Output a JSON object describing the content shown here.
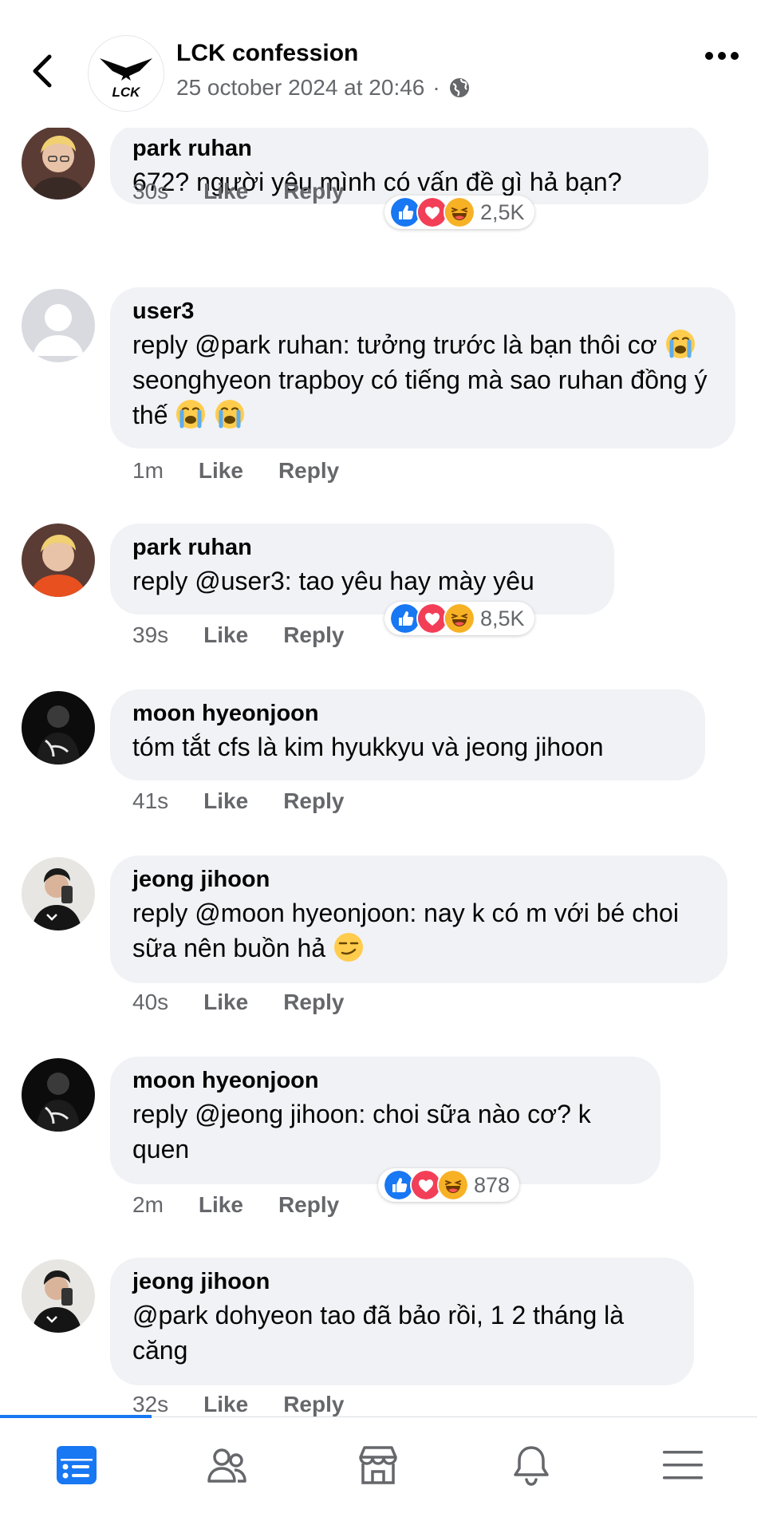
{
  "post": {
    "page_name": "LCK confession",
    "timestamp": "25 october 2024 at 20:46",
    "separator": "·",
    "logo_text": "LCK",
    "privacy_icon": "globe-icon"
  },
  "comments": [
    {
      "author": "park ruhan",
      "text": "672? người yêu mình có vấn đề gì hả bạn?",
      "time": "30s",
      "like": "Like",
      "reply": "Reply",
      "reactions": [
        "like",
        "love",
        "haha"
      ],
      "reaction_count": "2,5K"
    },
    {
      "author": "user3",
      "text_before": "reply @park ruhan: tưởng trước là bạn thôi cơ",
      "text_after": "seonghyeon trapboy có tiếng mà sao ruhan đồng ý thế",
      "emoji": [
        "loudly-crying-face",
        "loudly-crying-face",
        "loudly-crying-face"
      ],
      "time": "1m",
      "like": "Like",
      "reply": "Reply"
    },
    {
      "author": "park ruhan",
      "text": "reply @user3: tao yêu hay mày yêu",
      "time": "39s",
      "like": "Like",
      "reply": "Reply",
      "reactions": [
        "like",
        "love",
        "haha"
      ],
      "reaction_count": "8,5K"
    },
    {
      "author": "moon hyeonjoon",
      "text": "tóm tắt cfs là kim hyukkyu và jeong jihoon",
      "time": "41s",
      "like": "Like",
      "reply": "Reply"
    },
    {
      "author": "jeong jihoon",
      "text": "reply @moon hyeonjoon: nay k có m với bé choi sữa nên buồn hả",
      "emoji": [
        "smirking-face"
      ],
      "time": "40s",
      "like": "Like",
      "reply": "Reply"
    },
    {
      "author": "moon hyeonjoon",
      "text": "reply @jeong jihoon: choi sữa nào cơ? k quen",
      "time": "2m",
      "like": "Like",
      "reply": "Reply",
      "reactions": [
        "like",
        "love",
        "haha"
      ],
      "reaction_count": "878"
    },
    {
      "author": "jeong jihoon",
      "text": "@park dohyeon tao đã bảo rồi, 1 2 tháng là căng",
      "time": "32s",
      "like": "Like",
      "reply": "Reply"
    }
  ],
  "nav": {
    "items": [
      "feed-icon",
      "friends-icon",
      "marketplace-icon",
      "notifications-icon",
      "menu-icon"
    ],
    "active": "feed-icon"
  },
  "colors": {
    "accent": "#1877f2",
    "bubble": "#f0f2f5",
    "secondary_text": "#65676b",
    "love": "#f33e58",
    "haha": "#f7b125"
  }
}
